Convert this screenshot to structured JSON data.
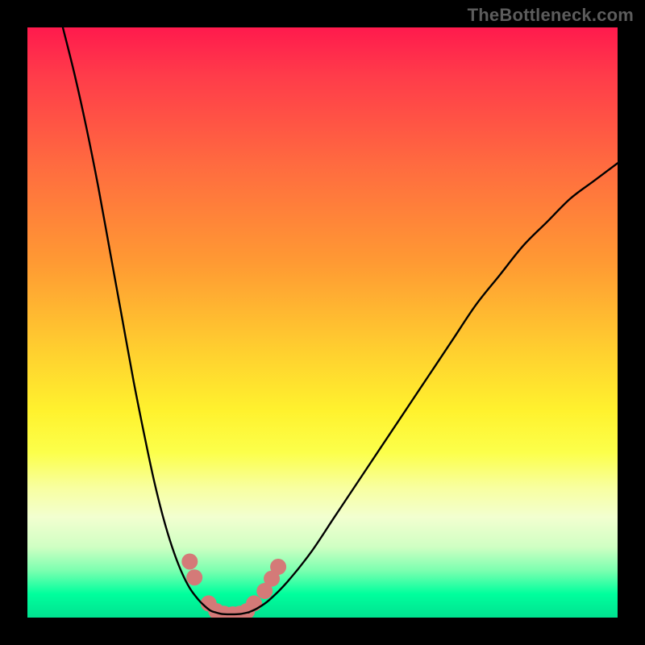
{
  "watermark": "TheBottleneck.com",
  "chart_data": {
    "type": "line",
    "title": "",
    "xlabel": "",
    "ylabel": "",
    "xlim": [
      0,
      100
    ],
    "ylim": [
      0,
      100
    ],
    "grid": false,
    "legend": false,
    "series": [
      {
        "name": "left-curve",
        "x": [
          6,
          8,
          10,
          12,
          14,
          16,
          18,
          20,
          21.5,
          23,
          24.5,
          26,
          27.5,
          29,
          30,
          31,
          31.8
        ],
        "y": [
          100,
          92,
          83,
          73,
          62,
          51,
          40,
          30,
          23,
          17,
          12,
          8,
          5,
          3,
          2,
          1.2,
          0.9
        ]
      },
      {
        "name": "right-curve",
        "x": [
          37.5,
          39,
          41,
          44,
          48,
          52,
          56,
          60,
          64,
          68,
          72,
          76,
          80,
          84,
          88,
          92,
          96,
          100
        ],
        "y": [
          0.9,
          1.6,
          3,
          6,
          11,
          17,
          23,
          29,
          35,
          41,
          47,
          53,
          58,
          63,
          67,
          71,
          74,
          77
        ]
      },
      {
        "name": "valley-floor",
        "x": [
          31.8,
          33,
          34.5,
          36,
          37.5
        ],
        "y": [
          0.9,
          0.6,
          0.55,
          0.6,
          0.9
        ]
      }
    ],
    "markers": {
      "name": "dots",
      "color": "#d47a78",
      "points": [
        {
          "x": 27.5,
          "y": 9.5
        },
        {
          "x": 28.3,
          "y": 6.8
        },
        {
          "x": 30.7,
          "y": 2.4
        },
        {
          "x": 32.0,
          "y": 1.1
        },
        {
          "x": 33.3,
          "y": 0.65
        },
        {
          "x": 34.8,
          "y": 0.55
        },
        {
          "x": 36.0,
          "y": 0.65
        },
        {
          "x": 37.2,
          "y": 1.1
        },
        {
          "x": 38.4,
          "y": 2.4
        },
        {
          "x": 40.2,
          "y": 4.5
        },
        {
          "x": 41.4,
          "y": 6.6
        },
        {
          "x": 42.5,
          "y": 8.6
        }
      ]
    },
    "gradient_stops": [
      {
        "pos": 0.0,
        "color": "#ff1a4d"
      },
      {
        "pos": 0.08,
        "color": "#ff3b4a"
      },
      {
        "pos": 0.24,
        "color": "#ff6d3f"
      },
      {
        "pos": 0.4,
        "color": "#ff9a33"
      },
      {
        "pos": 0.55,
        "color": "#ffd02f"
      },
      {
        "pos": 0.65,
        "color": "#fff22e"
      },
      {
        "pos": 0.72,
        "color": "#fcff4a"
      },
      {
        "pos": 0.78,
        "color": "#f8ffa0"
      },
      {
        "pos": 0.83,
        "color": "#f2ffd0"
      },
      {
        "pos": 0.88,
        "color": "#d0ffc3"
      },
      {
        "pos": 0.92,
        "color": "#7cffb0"
      },
      {
        "pos": 0.96,
        "color": "#00ff9d"
      },
      {
        "pos": 1.0,
        "color": "#00e290"
      }
    ]
  }
}
